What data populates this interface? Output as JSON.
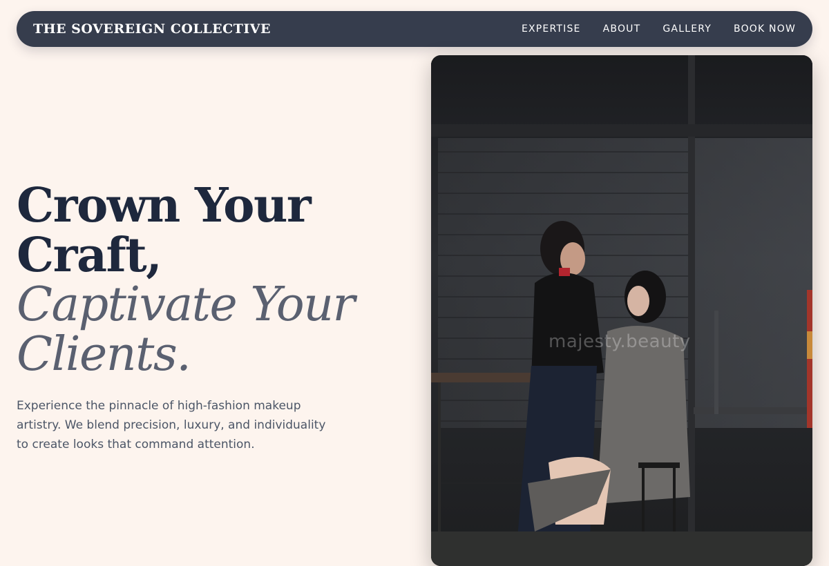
{
  "header": {
    "brand": "THE SOVEREIGN COLLECTIVE",
    "nav": [
      {
        "label": "EXPERTISE"
      },
      {
        "label": "ABOUT"
      },
      {
        "label": "GALLERY"
      },
      {
        "label": "BOOK NOW"
      }
    ]
  },
  "hero": {
    "headline_line1": "Crown Your",
    "headline_line2": "Craft,",
    "headline_line3": "Captivate Your",
    "headline_line4": "Clients.",
    "description": "Experience the pinnacle of high-fashion makeup artistry. We blend precision, luxury, and individuality to create looks that command attention.",
    "image_watermark": "majesty.beauty"
  },
  "colors": {
    "background": "#fdf4ee",
    "nav_background": "#363d4d",
    "headline_dark": "#1e283d",
    "headline_muted": "#5a6070",
    "body_text": "#4b5566"
  }
}
